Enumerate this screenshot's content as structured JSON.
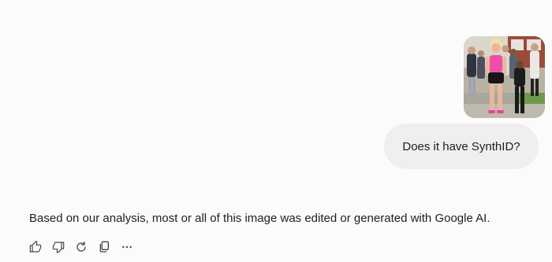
{
  "conversation": {
    "user_message": {
      "image_description": "Photo of a person in a pink top and black skirt walking past a group of students outside a brick building",
      "text": "Does it have SynthID?"
    },
    "assistant_response": {
      "text": "Based on our analysis, most or all of this image was edited or generated with Google AI."
    }
  },
  "actions": [
    {
      "icon": "thumbs-up-icon"
    },
    {
      "icon": "thumbs-down-icon"
    },
    {
      "icon": "refresh-icon"
    },
    {
      "icon": "copy-icon"
    },
    {
      "icon": "more-options-icon"
    }
  ],
  "colors": {
    "background": "#fcfbfb",
    "user_bubble": "#f0eeee",
    "text": "#1f1f1f",
    "icon": "#444746"
  }
}
